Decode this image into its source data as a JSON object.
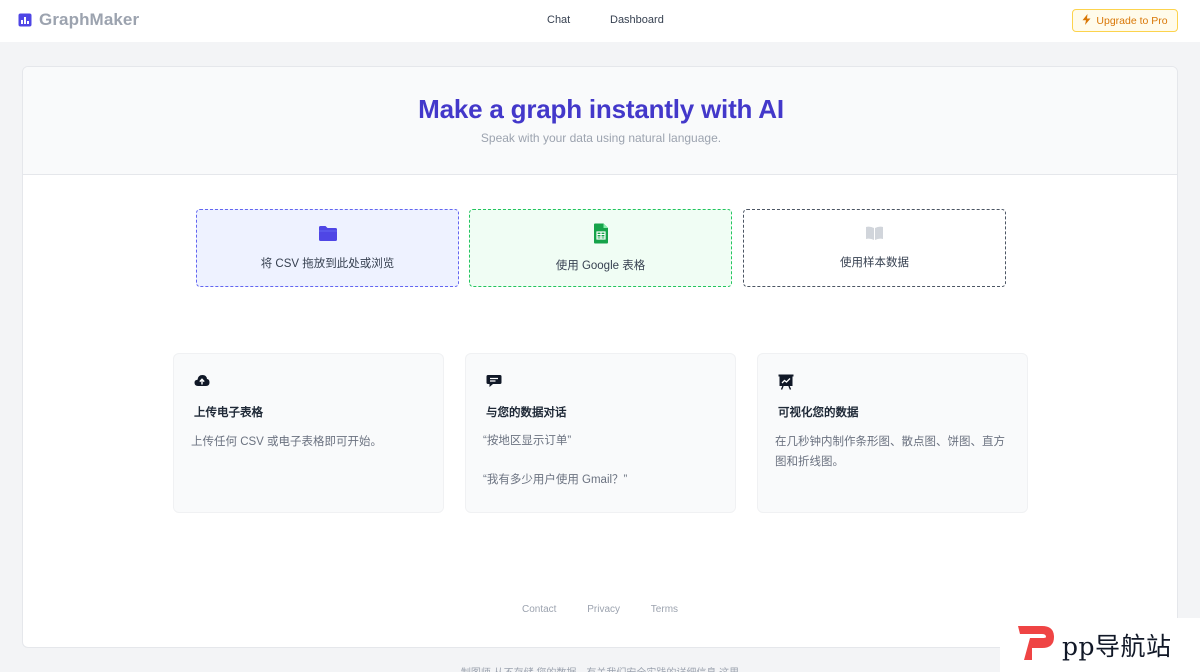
{
  "header": {
    "brand": "GraphMaker",
    "nav": [
      "Chat",
      "Dashboard"
    ],
    "upgrade_label": "Upgrade to Pro"
  },
  "hero": {
    "title": "Make a graph instantly with AI",
    "subtitle": "Speak with your data using natural language."
  },
  "options": [
    {
      "label": "将 CSV 拖放到此处或浏览",
      "icon": "folder-icon"
    },
    {
      "label": "使用 Google 表格",
      "icon": "google-sheets-icon"
    },
    {
      "label": "使用样本数据",
      "icon": "book-icon"
    }
  ],
  "features": [
    {
      "title": "上传电子表格",
      "desc": "上传任何 CSV 或电子表格即可开始。",
      "icon": "cloud-upload-icon"
    },
    {
      "title": "与您的数据对话",
      "examples": [
        "“按地区显示订单”",
        "“我有多少用户使用 Gmail？”"
      ],
      "icon": "chat-bubble-icon"
    },
    {
      "title": "可视化您的数据",
      "desc": "在几秒钟内制作条形图、散点图、饼图、直方图和折线图。",
      "icon": "chart-board-icon"
    }
  ],
  "footer": {
    "links": [
      "Contact",
      "Privacy",
      "Terms"
    ],
    "note": "制图师 从不存储 您的数据。有关我们安全实践的详细信息 这里"
  },
  "watermark": {
    "text": "pp导航站"
  },
  "colors": {
    "accent": "#4338ca",
    "upgrade": "#d97706",
    "csv_border": "#6366f1",
    "google_border": "#22c55e",
    "google_icon": "#16a34a"
  }
}
